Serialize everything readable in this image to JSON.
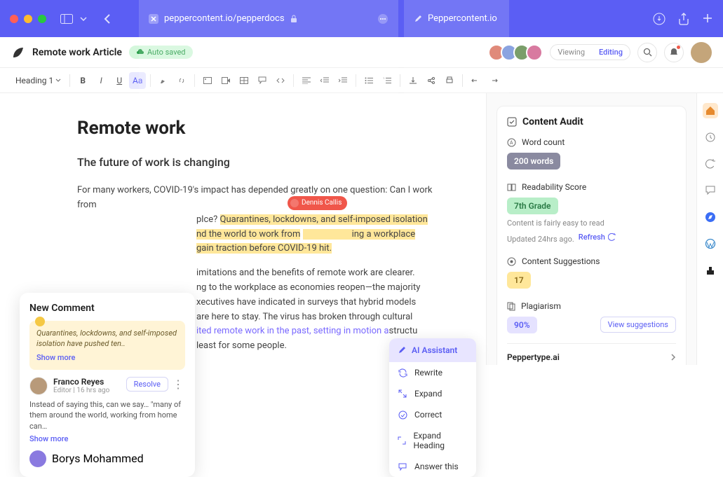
{
  "browser": {
    "url": "peppercontent.io/pepperdocs",
    "tab2": "Peppercontent.io"
  },
  "header": {
    "doc_title": "Remote work Article",
    "save_status": "Auto saved",
    "mode_view": "Viewing",
    "mode_edit": "Editing"
  },
  "toolbar": {
    "heading": "Heading 1"
  },
  "document": {
    "h1": "Remote work",
    "h2": "The future of work is changing",
    "p1_a": "For many workers, COVID-19's impact has depended greatly on one question: Can I work from",
    "p1_b": "plce? ",
    "p1_hl1": "Quarantines, lockdowns, and self-imposed isolation",
    "p1_c": "nd the world to work from",
    "p1_d": "ing a workplace",
    "p1_e": "gain traction before COVID-19 hit.",
    "p2_a": "imitations and the benefits of remote work are clearer.",
    "p2_b": "ng to the workplace as economies reopen—the majority ",
    "p2_c": "xecutives have indicated in surveys that hybrid models ",
    "p2_d": "are here to stay. The virus has broken through cultural",
    "p2_link": "ited remote work in the past, setting in motion a",
    "p2_e": "structu",
    "p2_f": "least for some people."
  },
  "presence": {
    "name": "Dennis Callis"
  },
  "comment": {
    "title": "New Comment",
    "quote": "Quarantines, lockdowns, and self-imposed isolation have pushed ten..",
    "show_more": "Show more",
    "reply_name": "Franco Reyes",
    "reply_meta": "Editor | 16 hrs ago",
    "resolve": "Resolve",
    "reply_body": "Instead of saying this, can we say… \"many of them around the world, working from home can…",
    "reply2_name": "Borys Mohammed"
  },
  "ai_menu": {
    "title": "AI Assistant",
    "items": [
      "Rewrite",
      "Expand",
      "Correct",
      "Expand Heading",
      "Answer this"
    ]
  },
  "audit": {
    "title": "Content Audit",
    "word_count_label": "Word count",
    "word_count_value": "200 words",
    "readability_label": "Readability Score",
    "readability_value": "7th Grade",
    "readability_note": "Content is fairly easy to read",
    "updated": "Updated 24hrs ago.",
    "refresh": "Refresh",
    "suggestions_label": "Content Suggestions",
    "suggestions_value": "17",
    "plagiarism_label": "Plagiarism",
    "plagiarism_value": "90%",
    "view_suggestions": "View suggestions",
    "peppertype": "Peppertype.ai"
  }
}
